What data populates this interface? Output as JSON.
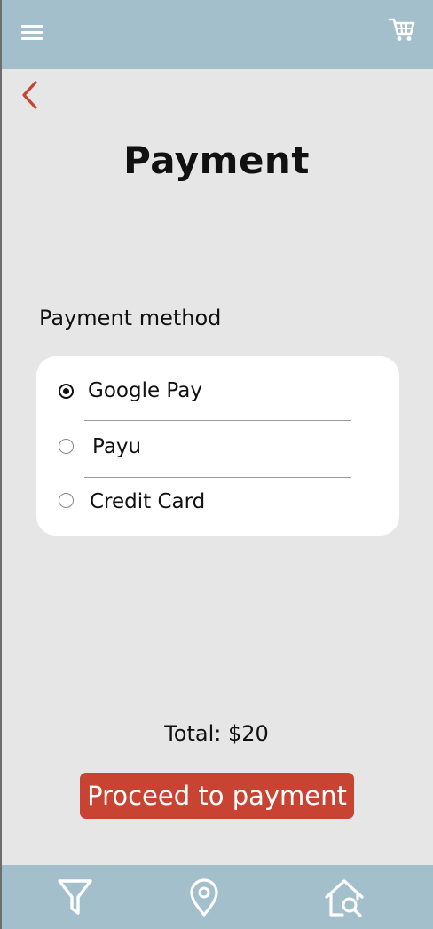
{
  "header": {
    "menu_icon": "hamburger-menu-icon",
    "cart_icon": "shopping-cart-icon"
  },
  "back_icon": "chevron-left-icon",
  "page": {
    "title": "Payment"
  },
  "payment": {
    "section_label": "Payment method",
    "options": [
      {
        "label": "Google Pay",
        "selected": true
      },
      {
        "label": "Payu",
        "selected": false
      },
      {
        "label": "Credit Card",
        "selected": false
      }
    ]
  },
  "summary": {
    "total_text": "Total: $20"
  },
  "actions": {
    "proceed_label": "Proceed to payment"
  },
  "bottom_nav": {
    "items": [
      {
        "icon": "filter-icon"
      },
      {
        "icon": "location-pin-icon"
      },
      {
        "icon": "home-search-icon"
      }
    ]
  },
  "colors": {
    "header_bg": "#a3bfcc",
    "page_bg": "#e6e6e6",
    "accent": "#c94332",
    "card_bg": "#ffffff"
  }
}
